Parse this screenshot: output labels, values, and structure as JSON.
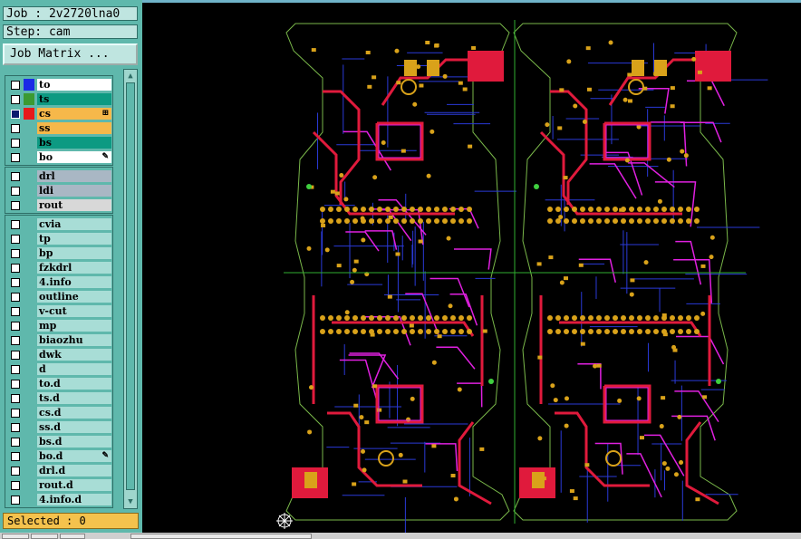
{
  "header": {
    "job": "Job : 2v2720lna0",
    "step": "Step: cam",
    "job_matrix_button": "Job Matrix ..."
  },
  "layer_groups": [
    [
      {
        "name": "to",
        "color": "#1a2be6",
        "bg": "#ffffff",
        "checked": false
      },
      {
        "name": "ts",
        "color": "#3b9a32",
        "bg": "#0d9a82",
        "checked": false
      },
      {
        "name": "cs",
        "color": "#e61a1a",
        "bg": "#f6b84a",
        "checked": true,
        "mark": "⊞"
      },
      {
        "name": "ss",
        "color": "",
        "bg": "#f6b84a",
        "checked": false
      },
      {
        "name": "bs",
        "color": "",
        "bg": "#0d9a82",
        "checked": false
      },
      {
        "name": "bo",
        "color": "",
        "bg": "#ffffff",
        "checked": false,
        "mark": "✎"
      }
    ],
    [
      {
        "name": "drl",
        "color": "",
        "bg": "#a9b7c4",
        "checked": false
      },
      {
        "name": "ldi",
        "color": "",
        "bg": "#a9b7c4",
        "checked": false
      },
      {
        "name": "rout",
        "color": "",
        "bg": "#d8d8d8",
        "checked": false
      }
    ],
    [
      {
        "name": "cvia",
        "color": "",
        "bg": "#a8ddd6",
        "checked": false
      },
      {
        "name": "tp",
        "color": "",
        "bg": "#a8ddd6",
        "checked": false
      },
      {
        "name": "bp",
        "color": "",
        "bg": "#a8ddd6",
        "checked": false
      },
      {
        "name": "fzkdrl",
        "color": "",
        "bg": "#a8ddd6",
        "checked": false
      },
      {
        "name": "4.info",
        "color": "",
        "bg": "#a8ddd6",
        "checked": false
      },
      {
        "name": "outline",
        "color": "",
        "bg": "#a8ddd6",
        "checked": false
      },
      {
        "name": "v-cut",
        "color": "",
        "bg": "#a8ddd6",
        "checked": false
      },
      {
        "name": "mp",
        "color": "",
        "bg": "#a8ddd6",
        "checked": false
      },
      {
        "name": "biaozhu",
        "color": "",
        "bg": "#a8ddd6",
        "checked": false
      },
      {
        "name": "dwk",
        "color": "",
        "bg": "#a8ddd6",
        "checked": false
      },
      {
        "name": "d",
        "color": "",
        "bg": "#a8ddd6",
        "checked": false
      },
      {
        "name": "to.d",
        "color": "",
        "bg": "#a8ddd6",
        "checked": false
      },
      {
        "name": "ts.d",
        "color": "",
        "bg": "#a8ddd6",
        "checked": false
      },
      {
        "name": "cs.d",
        "color": "",
        "bg": "#a8ddd6",
        "checked": false
      },
      {
        "name": "ss.d",
        "color": "",
        "bg": "#a8ddd6",
        "checked": false
      },
      {
        "name": "bs.d",
        "color": "",
        "bg": "#a8ddd6",
        "checked": false
      },
      {
        "name": "bo.d",
        "color": "",
        "bg": "#a8ddd6",
        "checked": false,
        "mark": "✎"
      },
      {
        "name": "drl.d",
        "color": "",
        "bg": "#a8ddd6",
        "checked": false
      },
      {
        "name": "rout.d",
        "color": "",
        "bg": "#a8ddd6",
        "checked": false
      },
      {
        "name": "4.info.d",
        "color": "",
        "bg": "#a8ddd6",
        "checked": false
      }
    ]
  ],
  "status": {
    "selected": "Selected : 0"
  },
  "pcb_colors": {
    "trace": "#e01a3c",
    "pad": "#d9a21a",
    "blue": "#2a3ad8",
    "magenta": "#e020e0",
    "outline": "#7ab84a",
    "crosshair": "#2fae2f"
  }
}
